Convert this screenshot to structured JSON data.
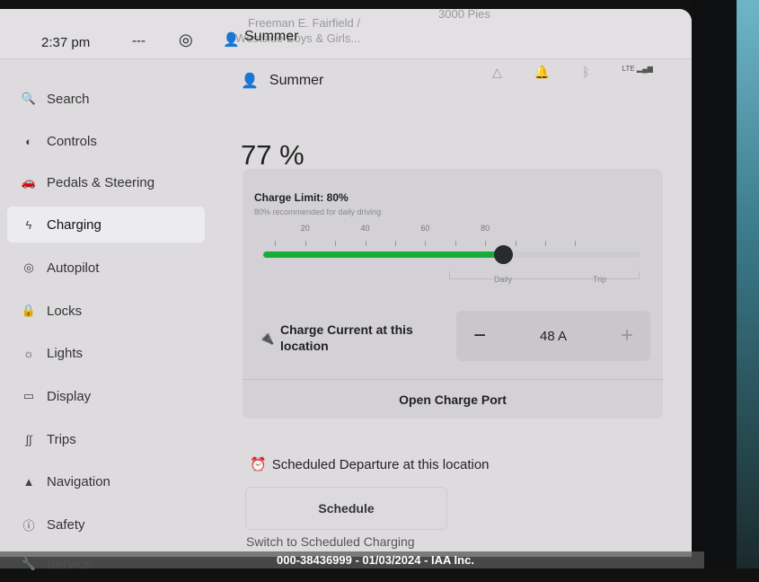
{
  "status_bar": {
    "time": "2:37 pm",
    "dashes": "---",
    "user": "Summer",
    "map_label_1": "Freeman E. Fairfield /",
    "map_label_2": "Westside Boys & Girls...",
    "map_label_3": "3000 Pies"
  },
  "sidebar": {
    "items": [
      {
        "label": "Search",
        "icon": "🔍"
      },
      {
        "label": "Controls",
        "icon": "◐"
      },
      {
        "label": "Pedals & Steering",
        "icon": "🚗"
      },
      {
        "label": "Charging",
        "icon": "ϟ",
        "active": true
      },
      {
        "label": "Autopilot",
        "icon": "◎"
      },
      {
        "label": "Locks",
        "icon": "🔒"
      },
      {
        "label": "Lights",
        "icon": "☼"
      },
      {
        "label": "Display",
        "icon": "▭"
      },
      {
        "label": "Trips",
        "icon": "∫∫"
      },
      {
        "label": "Navigation",
        "icon": "▲"
      },
      {
        "label": "Safety",
        "icon": "ⓘ"
      },
      {
        "label": "Service",
        "icon": "🔧"
      }
    ]
  },
  "header": {
    "user": "Summer",
    "lte": "LTE"
  },
  "battery_percent": "77 %",
  "charge_limit": {
    "title": "Charge Limit: 80%",
    "subtitle": "80% recommended for daily driving",
    "value": 80,
    "ticks": [
      "20",
      "40",
      "60",
      "80"
    ],
    "daily_label": "Daily",
    "trip_label": "Trip",
    "accent": "#17ad38"
  },
  "charge_current": {
    "label": "Charge Current at this location",
    "value": "48 A",
    "minus": "−",
    "plus": "+"
  },
  "open_charge_port": "Open Charge Port",
  "scheduled": {
    "title": "Scheduled Departure at this location",
    "button": "Schedule",
    "next": "Switch to Scheduled Charging"
  },
  "watermark": "000-38436999 - 01/03/2024 - IAA Inc."
}
